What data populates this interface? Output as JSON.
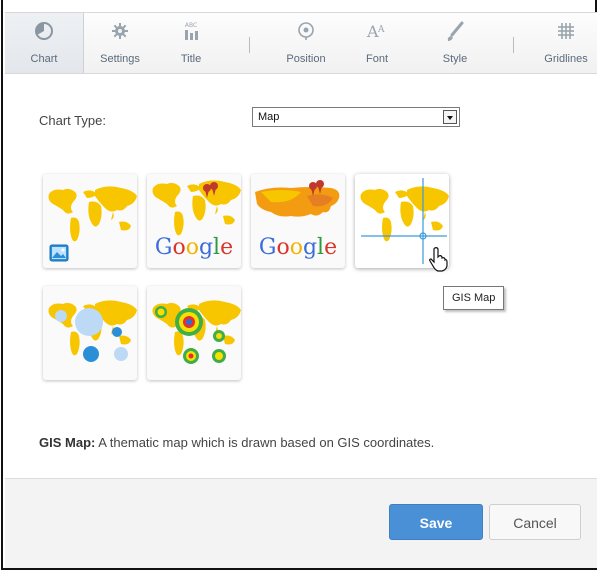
{
  "toolbar": {
    "items": [
      {
        "label": "Chart",
        "icon": "chart-icon",
        "active": true
      },
      {
        "label": "Settings",
        "icon": "gear-icon"
      },
      {
        "label": "Title",
        "icon": "title-icon"
      },
      {
        "label": "Position",
        "icon": "position-icon"
      },
      {
        "label": "Font",
        "icon": "font-icon"
      },
      {
        "label": "Style",
        "icon": "brush-icon"
      },
      {
        "label": "Gridlines",
        "icon": "gridlines-icon"
      }
    ]
  },
  "chart_type": {
    "label": "Chart Type:",
    "selected": "Map"
  },
  "thumbnails": [
    {
      "name": "image-map",
      "icon": "image-icon"
    },
    {
      "name": "google-world-map",
      "brand": "Google"
    },
    {
      "name": "google-us-map",
      "brand": "Google"
    },
    {
      "name": "gis-map"
    },
    {
      "name": "bubble-map"
    },
    {
      "name": "heat-map"
    }
  ],
  "tooltip": "GIS Map",
  "description": {
    "title": "GIS Map:",
    "text": " A thematic map which is drawn based on GIS coordinates."
  },
  "buttons": {
    "save": "Save",
    "cancel": "Cancel"
  },
  "colors": {
    "accent": "#4a90d6",
    "map_yellow": "#f7c600",
    "toolbar_label": "#5a6a7a"
  }
}
